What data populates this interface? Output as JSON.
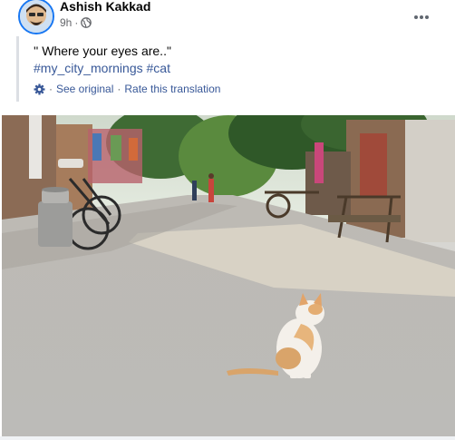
{
  "post": {
    "author": "Ashish Kakkad",
    "time": "9h",
    "caption": "'' Where your eyes are..\"",
    "hashtags": [
      "#my_city_mornings",
      "#cat"
    ],
    "see_original": "See original",
    "separator": "·",
    "rate_translation": "Rate this translation"
  },
  "icons": {
    "privacy": "globe-icon",
    "translate": "gear-icon",
    "more": "more-options-icon"
  },
  "colors": {
    "link": "#385898",
    "meta": "#65676b",
    "avatar_ring": "#1877f2"
  }
}
